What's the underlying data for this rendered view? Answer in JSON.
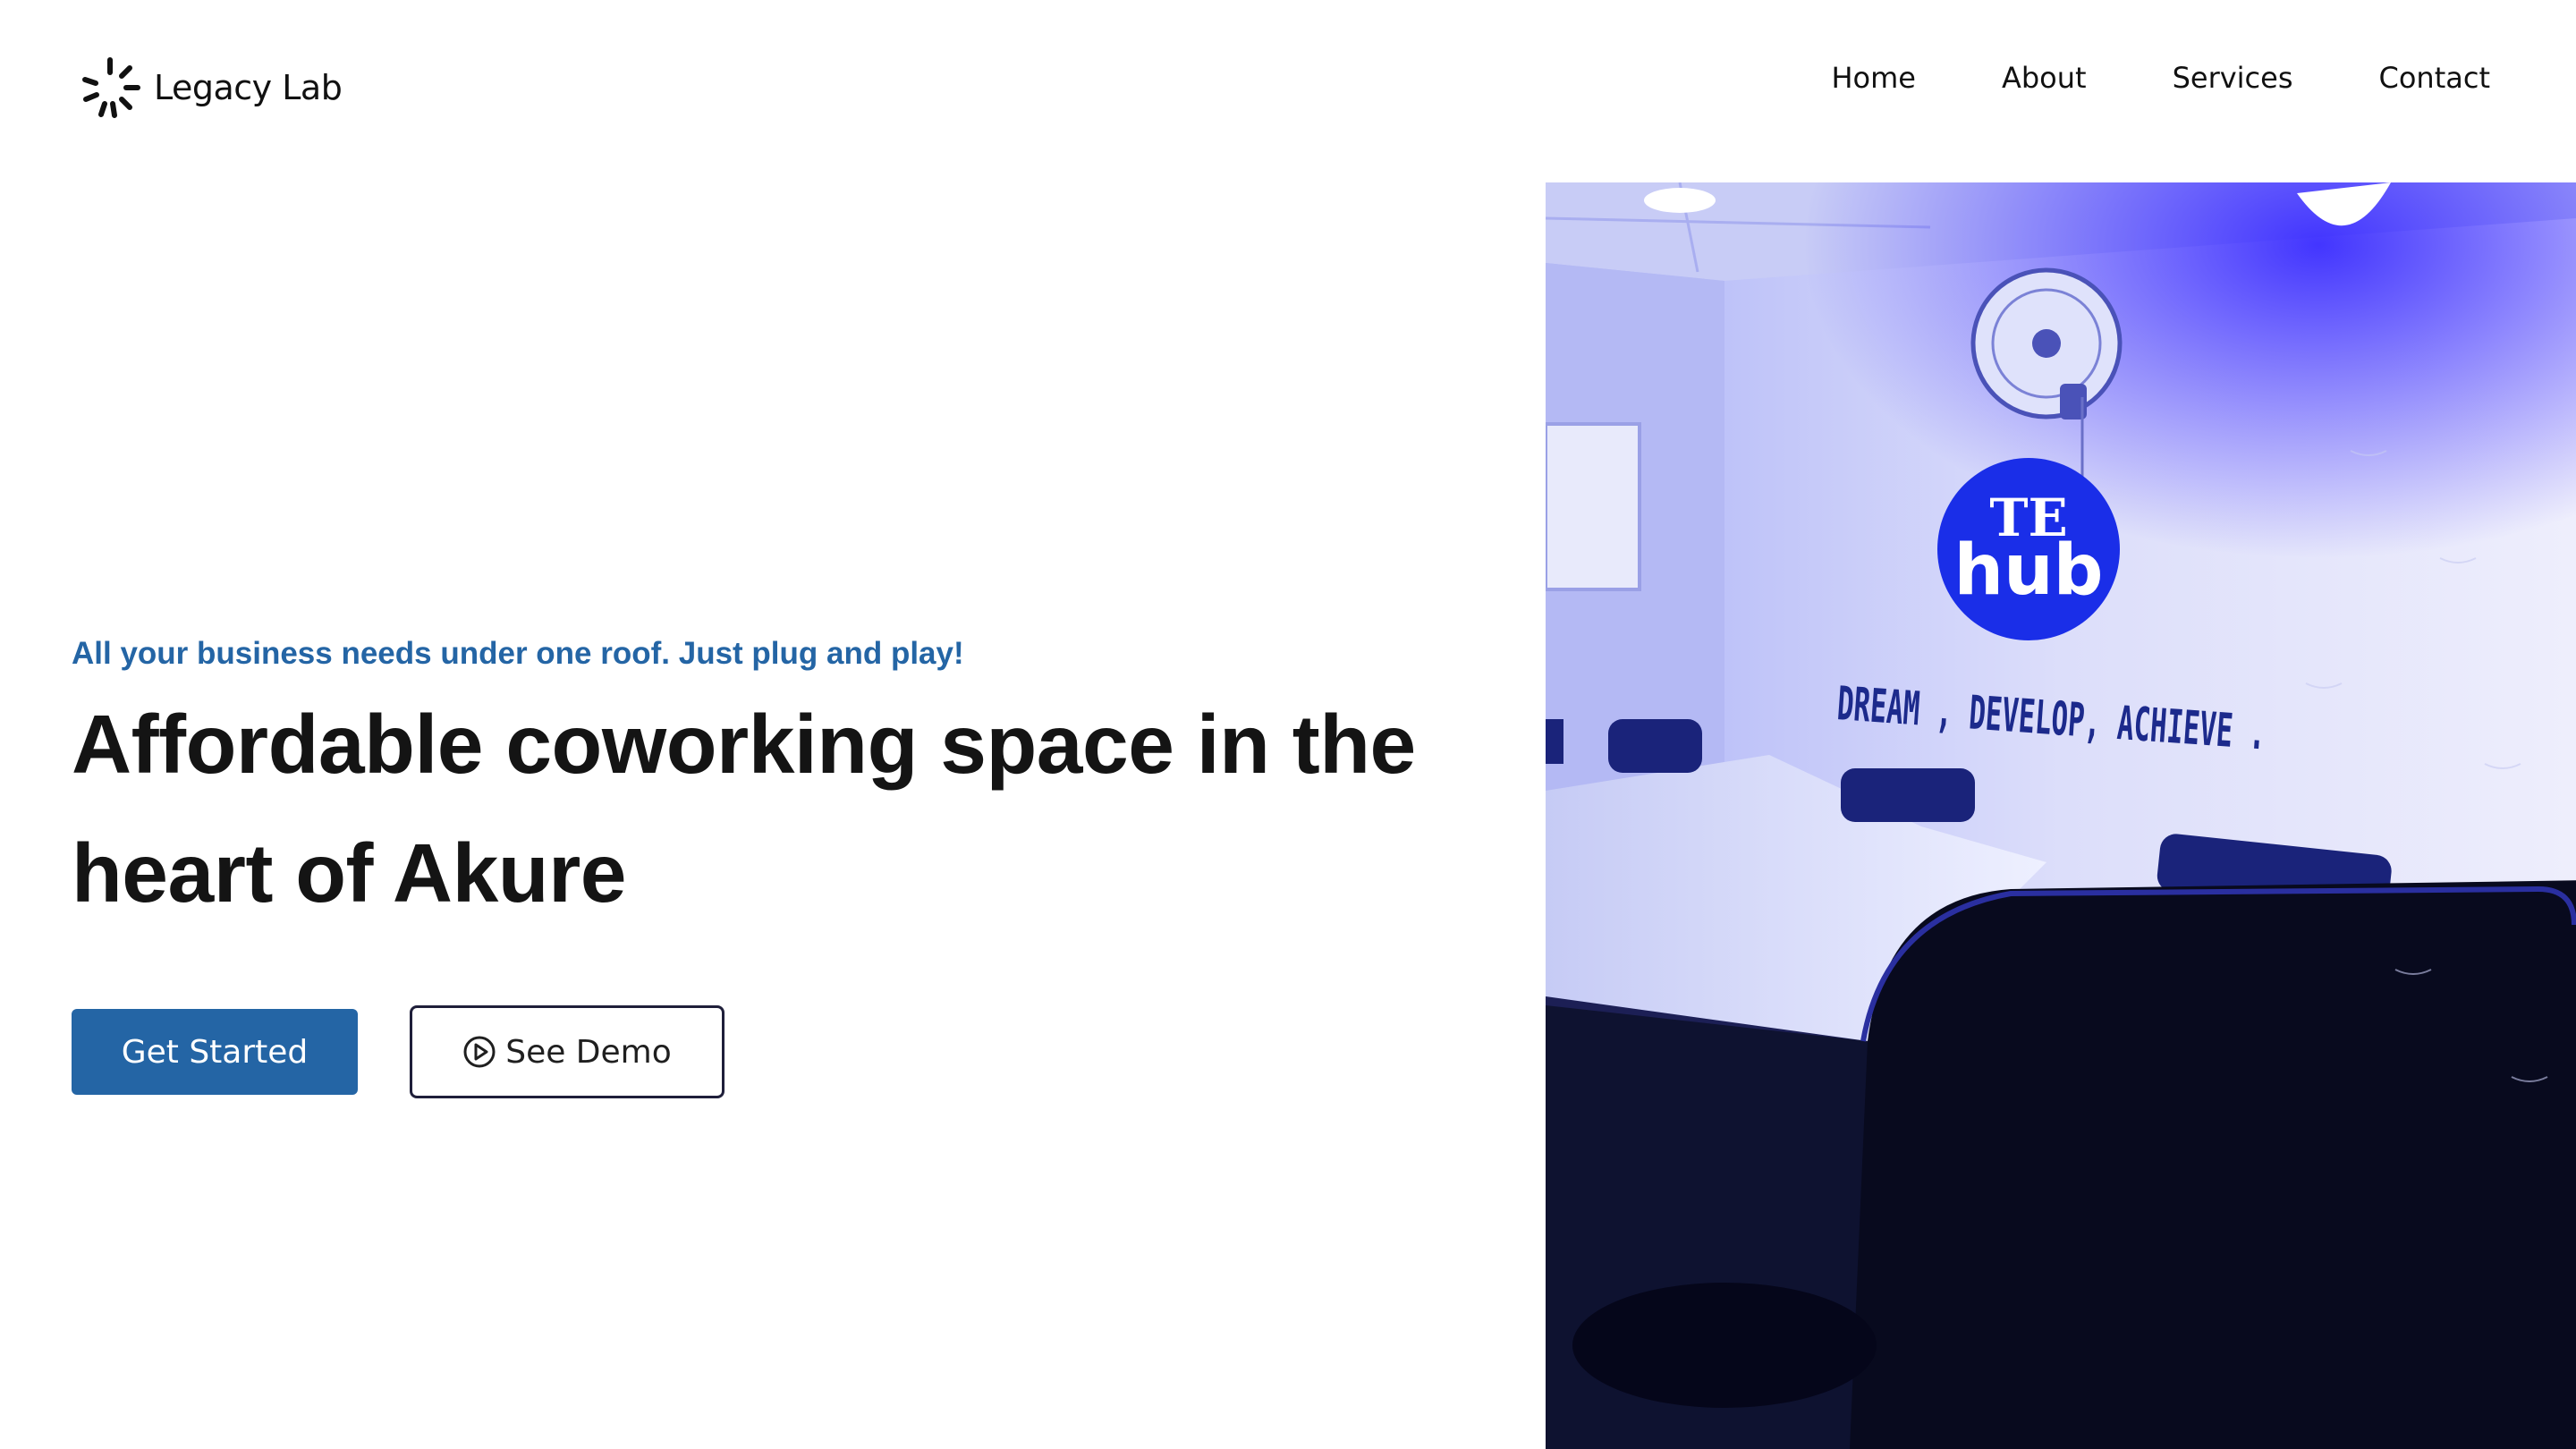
{
  "brand": {
    "name": "Legacy Lab",
    "logo_icon": "sunburst-icon"
  },
  "nav": {
    "items": [
      {
        "label": "Home"
      },
      {
        "label": "About"
      },
      {
        "label": "Services"
      },
      {
        "label": "Contact"
      }
    ]
  },
  "hero": {
    "tagline": "All your business needs under one roof. Just plug and play!",
    "headline_line1": "Affordable coworking space in the",
    "headline_line2": "heart of Akure",
    "primary_cta": "Get Started",
    "secondary_cta": "See Demo",
    "secondary_cta_icon": "play-circle-icon",
    "photo": {
      "wall_logo_line1": "TE",
      "wall_logo_line2": "hub",
      "wall_slogan": "DREAM , DEVELOP, ACHIEVE ."
    }
  },
  "colors": {
    "accent": "#2465a5",
    "heading": "#141414",
    "photo_tint": "#2a2aff"
  }
}
